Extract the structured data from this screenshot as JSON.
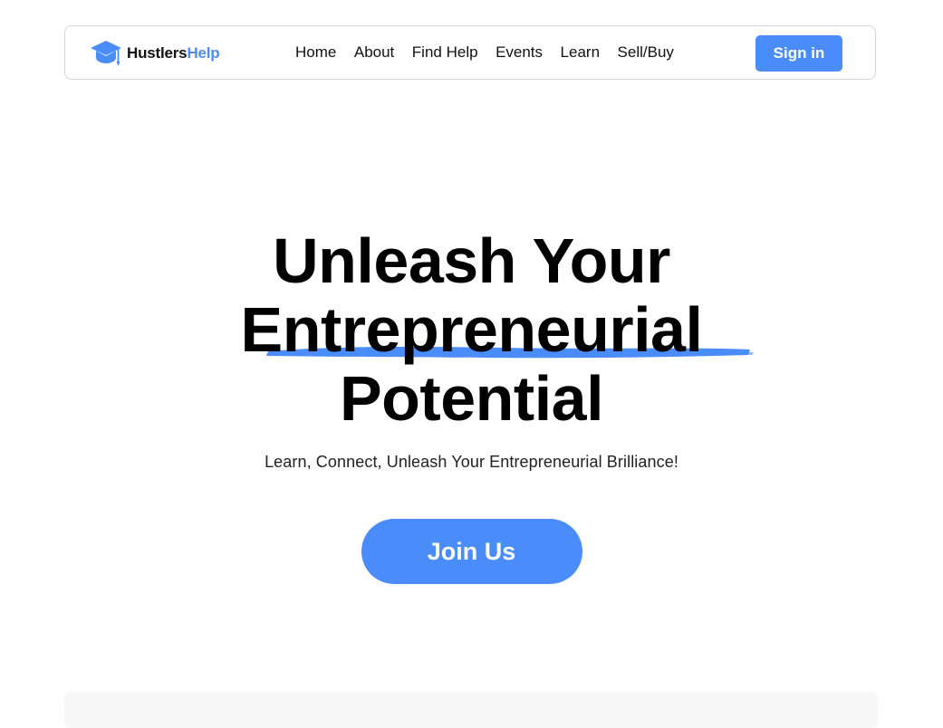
{
  "navbar": {
    "brand": {
      "part1": "Hustlers",
      "part2": "Help",
      "icon": "graduation-cap-icon"
    },
    "links": [
      "Home",
      "About",
      "Find Help",
      "Events",
      "Learn",
      "Sell/Buy"
    ],
    "signin_label": "Sign in"
  },
  "hero": {
    "title_line1": "Unleash Your",
    "title_line2": "Entrepreneurial",
    "title_line3": "Potential",
    "subtitle": "Learn, Connect, Unleash Your Entrepreneurial Brilliance!",
    "cta_label": "Join Us"
  },
  "colors": {
    "accent": "#4a8dfa",
    "text": "#000000",
    "border": "#d4d4d4",
    "panel": "#f7f7f7"
  }
}
